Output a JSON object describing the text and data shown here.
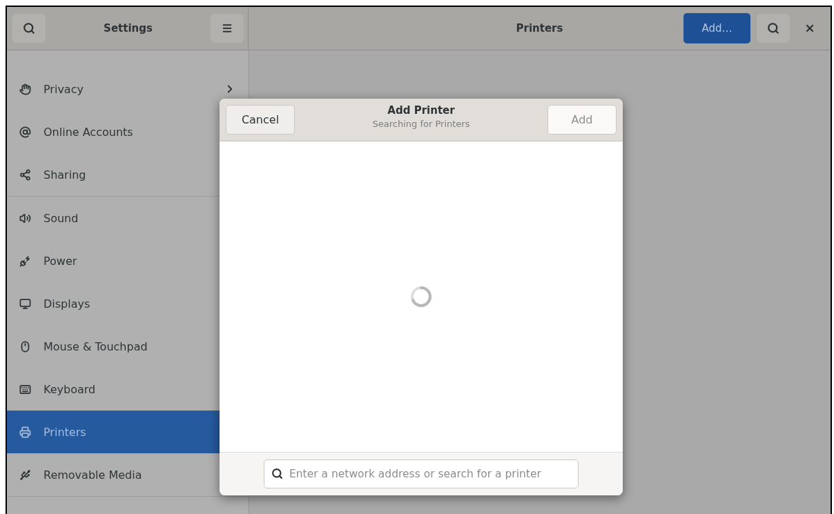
{
  "sidebar": {
    "title": "Settings",
    "groups": [
      {
        "items": [
          {
            "label": "Privacy",
            "selected": false,
            "chevron": true
          },
          {
            "label": "Online Accounts",
            "selected": false
          },
          {
            "label": "Sharing",
            "selected": false
          }
        ]
      },
      {
        "items": [
          {
            "label": "Sound",
            "selected": false
          },
          {
            "label": "Power",
            "selected": false
          },
          {
            "label": "Displays",
            "selected": false
          },
          {
            "label": "Mouse & Touchpad",
            "selected": false
          },
          {
            "label": "Keyboard",
            "selected": false
          },
          {
            "label": "Printers",
            "selected": true
          },
          {
            "label": "Removable Media",
            "selected": false
          }
        ]
      }
    ]
  },
  "main": {
    "title": "Printers",
    "add_button": "Add…"
  },
  "dialog": {
    "title": "Add Printer",
    "subtitle": "Searching for Printers",
    "cancel": "Cancel",
    "confirm": "Add",
    "confirm_disabled": true,
    "loading": true,
    "search": {
      "placeholder": "Enter a network address or search for a printer"
    }
  }
}
